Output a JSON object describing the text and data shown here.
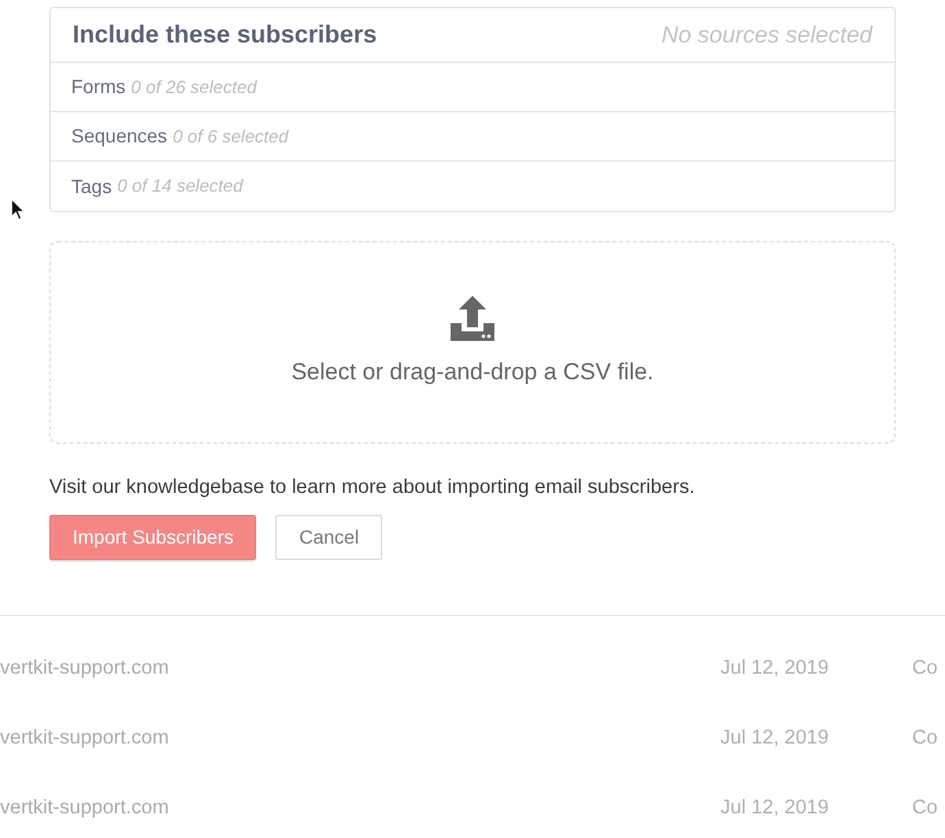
{
  "source_panel": {
    "title": "Include these subscribers",
    "status": "No sources selected",
    "rows": [
      {
        "label": "Forms",
        "count": "0 of 26 selected"
      },
      {
        "label": "Sequences",
        "count": "0 of 6 selected"
      },
      {
        "label": "Tags",
        "count": "0 of 14 selected"
      }
    ]
  },
  "upload": {
    "prompt": "Select or drag-and-drop a CSV file."
  },
  "help_text": "Visit our knowledgebase to learn more about importing email subscribers.",
  "buttons": [
    {
      "label": "Import Subscribers",
      "kind": "primary"
    },
    {
      "label": "Cancel",
      "kind": "secondary"
    }
  ],
  "background_table": {
    "rows": [
      {
        "column_1": "vertkit-support.com",
        "column_2": "Jul 12, 2019",
        "column_3": "Co"
      },
      {
        "column_1": "vertkit-support.com",
        "column_2": "Jul 12, 2019",
        "column_3": "Co"
      },
      {
        "column_1": "vertkit-support.com",
        "column_2": "Jul 12, 2019",
        "column_3": "Co"
      }
    ]
  }
}
